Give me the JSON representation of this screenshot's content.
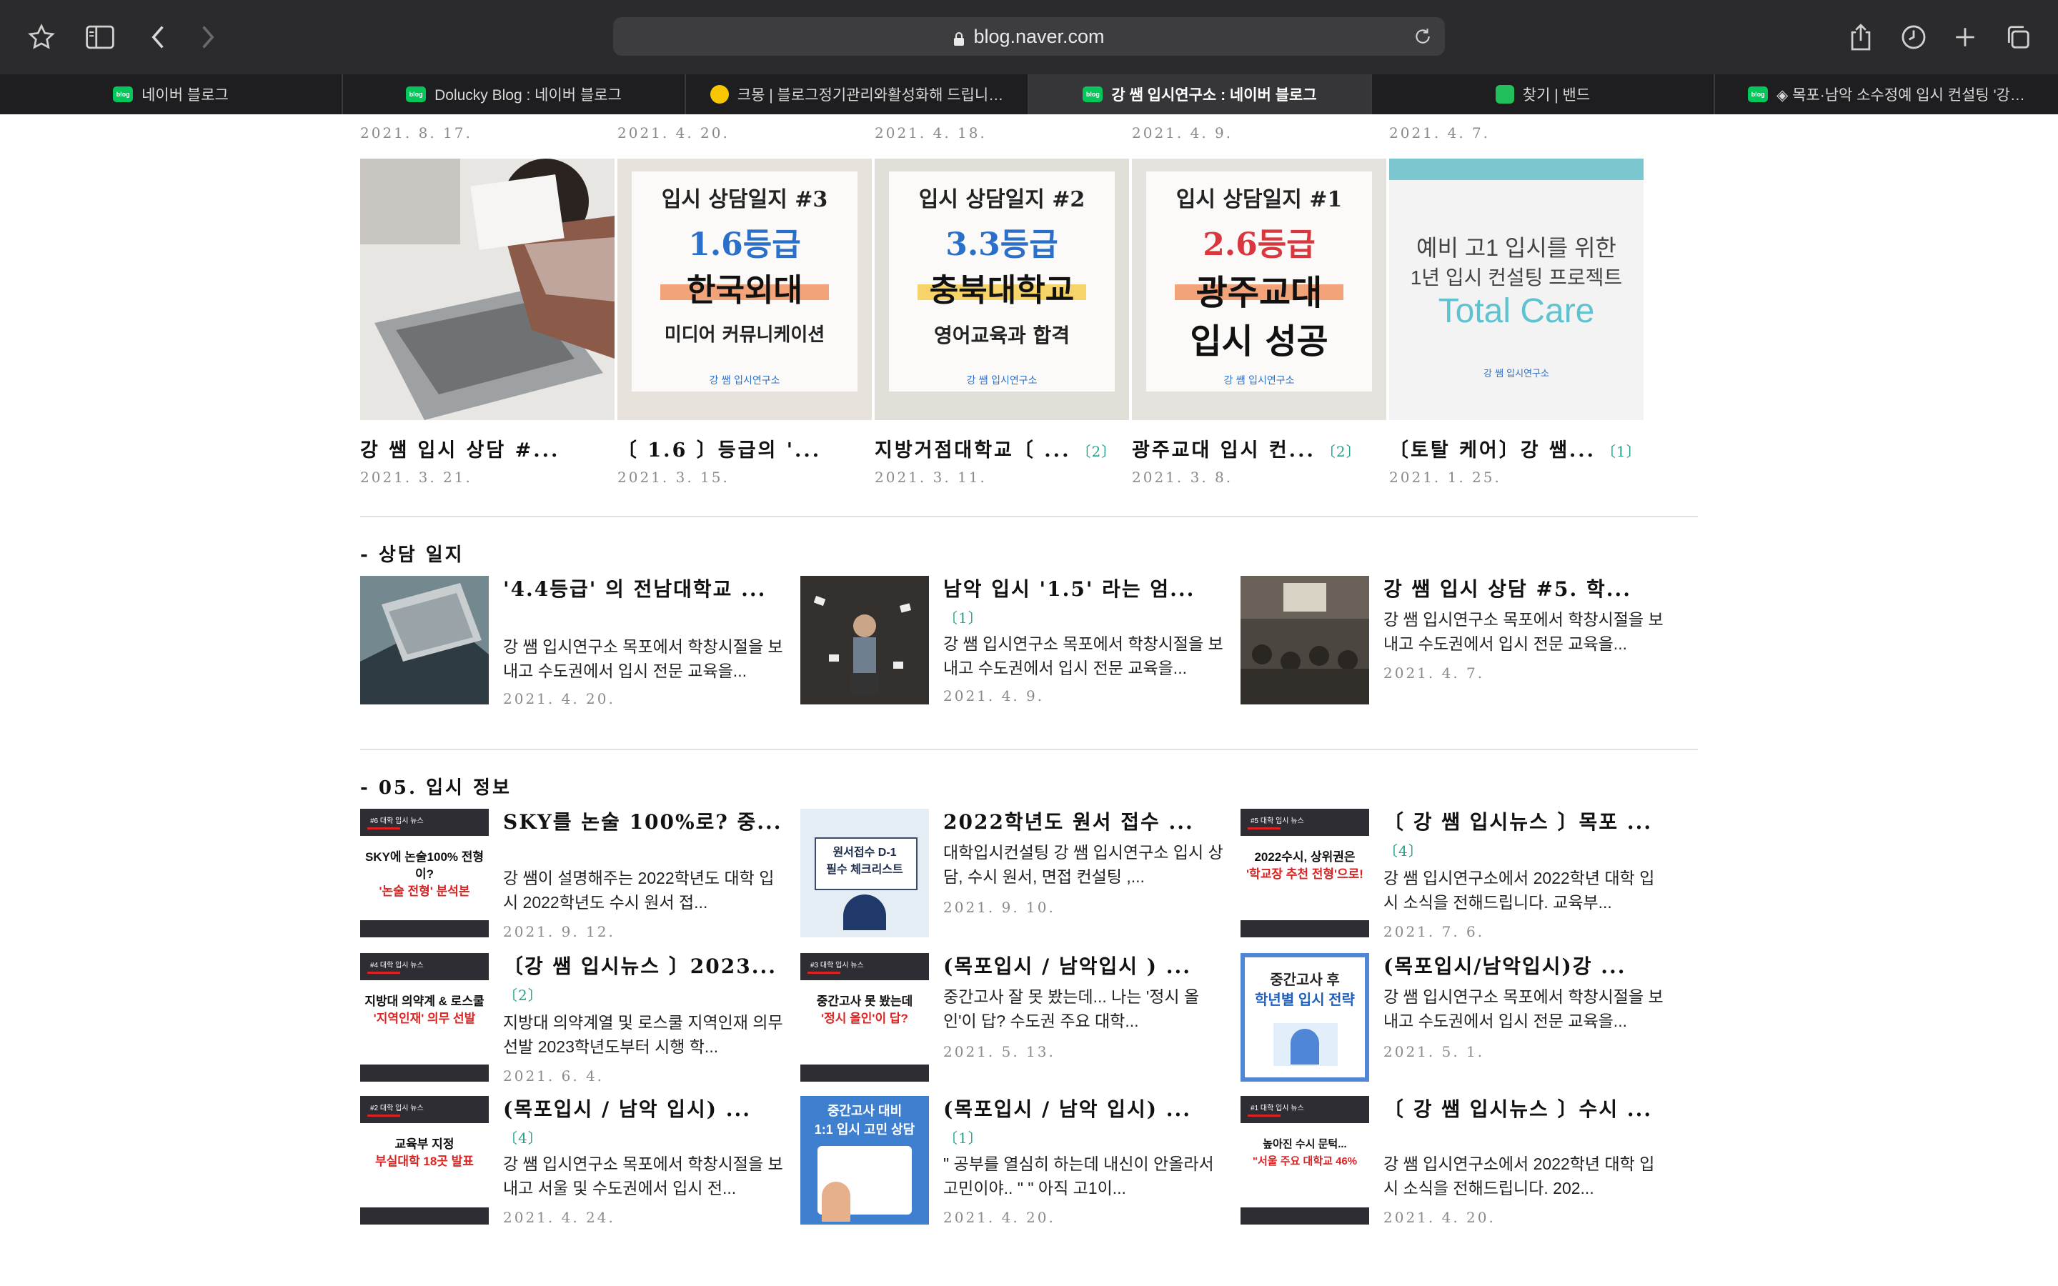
{
  "browser": {
    "url": "blog.naver.com",
    "tabs": [
      {
        "title": "네이버 블로그",
        "favicon": "blog",
        "active": false
      },
      {
        "title": "Dolucky Blog : 네이버 블로그",
        "favicon": "blog",
        "active": false
      },
      {
        "title": "크몽 | 블로그정기관리와활성화해 드립니…",
        "favicon": "kmong",
        "active": false
      },
      {
        "title": "강 쌤 입시연구소 : 네이버 블로그",
        "favicon": "blog",
        "active": true
      },
      {
        "title": "찾기 | 밴드",
        "favicon": "band",
        "active": false
      },
      {
        "title": "◈ 목포·남악 소수정예 입시 컨설팅 '강…",
        "favicon": "blog",
        "active": false
      }
    ]
  },
  "top_dates": [
    "2021. 8. 17.",
    "2021. 4. 20.",
    "2021. 4. 18.",
    "2021. 4. 9.",
    "2021. 4. 7."
  ],
  "gallery": [
    {
      "title": "강 쌤 입시 상담 #...",
      "count": "",
      "date": "2021. 3. 21.",
      "thumb": {
        "kind": "photo"
      }
    },
    {
      "title": "〔 1.6 〕등급의 '...",
      "count": "",
      "date": "2021. 3. 15.",
      "thumb": {
        "kind": "card",
        "line1": "입시 상담일지 #3",
        "grade": "1.6등급",
        "school": "한국외대",
        "major": "미디어 커뮤니케이션",
        "accent": "#2a6fc9",
        "logo": "강 쌤 입시연구소"
      }
    },
    {
      "title": "지방거점대학교〔 ...",
      "count": "〔2〕",
      "date": "2021. 3. 11.",
      "thumb": {
        "kind": "card",
        "line1": "입시 상담일지 #2",
        "grade": "3.3등급",
        "school": "충북대학교",
        "major": "영어교육과 합격",
        "accent": "#2a6fc9",
        "logo": "강 쌤 입시연구소"
      }
    },
    {
      "title": "광주교대 입시 컨...",
      "count": "〔2〕",
      "date": "2021. 3. 8.",
      "thumb": {
        "kind": "card3",
        "line1": "입시 상담일지 #1",
        "grade": "2.6등급",
        "school": "광주교대",
        "major": "입시 성공",
        "accent": "#d9363e",
        "logo": "강 쌤 입시연구소"
      }
    },
    {
      "title": "〔토탈 케어〕강 쌤...",
      "count": "〔1〕",
      "date": "2021. 1. 25.",
      "thumb": {
        "kind": "total",
        "line1": "예비 고1 입시를 위한",
        "line2": "1년 입시 컨설팅 프로젝트",
        "line3": "Total Care",
        "logo": "강 쌤 입시연구소"
      }
    }
  ],
  "sections": [
    {
      "name": "- 상담 일지",
      "items": [
        {
          "title": "'4.4등급' 의 전남대학교 ...",
          "count": "",
          "desc": "강 쌤 입시연구소 목포에서 학창시절을 보내고 수도권에서 입시 전문 교육을...",
          "date": "2021. 4. 20.",
          "thumb": {
            "kind": "photo-laptop"
          }
        },
        {
          "title": "남악 입시 '1.5' 라는 엄...",
          "count": "〔1〕",
          "desc": "강 쌤 입시연구소 목포에서 학창시절을 보내고 수도권에서 입시 전문 교육을...",
          "date": "2021. 4. 9.",
          "thumb": {
            "kind": "photo-dark"
          }
        },
        {
          "title": "강 쌤 입시 상담 #5. 학...",
          "count": "",
          "desc": "강 쌤 입시연구소 목포에서 학창시절을 보내고 수도권에서 입시 전문 교육을...",
          "date": "2021. 4. 7.",
          "thumb": {
            "kind": "photo-room"
          }
        }
      ]
    },
    {
      "name": "- 05. 입시 정보",
      "items": [
        {
          "title": "SKY를 논술 100%로? 중...",
          "count": "",
          "desc": "강 쌤이 설명해주는 2022학년도 대학 입시 2022학년도 수시 원서 접...",
          "date": "2021. 9. 12.",
          "thumb": {
            "kind": "news",
            "tag": "#6 대학 입시 뉴스",
            "lines": [
              "SKY에 논술100% 전형이?",
              "'논술 전형' 분석본"
            ]
          }
        },
        {
          "title": "2022학년도 원서 접수 ...",
          "count": "",
          "desc": "대학입시컨설팅 강 쌤 입시연구소 입시 상담, 수시 원서, 면접 컨설팅 ,...",
          "date": "2021. 9. 10.",
          "thumb": {
            "kind": "light",
            "lines": [
              "원서접수 D-1",
              "필수 체크리스트"
            ]
          }
        },
        {
          "title": "〔 강 쌤 입시뉴스 〕목포 ...",
          "count": "〔4〕",
          "desc": "강 쌤 입시연구소에서 2022학년 대학 입시 소식을 전해드립니다. 교육부...",
          "date": "2021. 7. 6.",
          "thumb": {
            "kind": "news",
            "tag": "#5 대학 입시 뉴스",
            "lines": [
              "2022수시, 상위권은",
              "'학교장 추천 전형'으로!"
            ]
          }
        },
        {
          "title": "〔강 쌤 입시뉴스 〕2023...",
          "count": "〔2〕",
          "desc": "지방대 의약계열 및 로스쿨 지역인재 의무 선발 2023학년도부터 시행 학...",
          "date": "2021. 6. 4.",
          "thumb": {
            "kind": "news",
            "tag": "#4 대학 입시 뉴스",
            "lines": [
              "지방대 의약계 & 로스쿨",
              "'지역인재' 의무 선발"
            ]
          }
        },
        {
          "title": "(목포입시 / 남악입시 ) ...",
          "count": "",
          "desc": "중간고사 잘 못 봤는데... 나는 '정시 올인'이 답? 수도권 주요 대학...",
          "date": "2021. 5. 13.",
          "thumb": {
            "kind": "news",
            "tag": "#3 대학 입시 뉴스",
            "lines": [
              "중간고사 못 봤는데",
              "'정시 올인'이 답?"
            ]
          }
        },
        {
          "title": "(목포입시/남악입시)강 ...",
          "count": "",
          "desc": "강 쌤 입시연구소 목포에서 학창시절을 보내고 수도권에서 입시 전문 교육을...",
          "date": "2021. 5. 1.",
          "thumb": {
            "kind": "blue",
            "lines": [
              "중간고사 후",
              "학년별 입시 전략"
            ]
          }
        },
        {
          "title": "(목포입시 / 남악 입시) ...",
          "count": "〔4〕",
          "desc": "강 쌤 입시연구소 목포에서 학창시절을 보내고 서울 및 수도권에서 입시 전...",
          "date": "2021. 4. 24.",
          "thumb": {
            "kind": "news",
            "tag": "#2 대학 입시 뉴스",
            "lines": [
              "교육부 지정",
              "부실대학 18곳 발표"
            ]
          }
        },
        {
          "title": "(목포입시 / 남악 입시) ...",
          "count": "〔1〕",
          "desc": "\" 공부를 열심히 하는데 내신이 안올라서 고민이야.. \" \" 아직 고1이...",
          "date": "2021. 4. 20.",
          "thumb": {
            "kind": "blue2",
            "lines": [
              "중간고사 대비",
              "1:1 입시 고민 상담"
            ]
          }
        },
        {
          "title": "〔 강 쌤 입시뉴스 〕수시 ...",
          "count": "",
          "desc": "강 쌤 입시연구소에서 2022학년 대학 입시 소식을 전해드립니다. 202...",
          "date": "2021. 4. 20.",
          "thumb": {
            "kind": "news",
            "tag": "#1 대학 입시 뉴스",
            "lines": [
              "높아진 수시 문턱...",
              "\"서울 주요 대학교 46%"
            ]
          }
        }
      ]
    }
  ]
}
